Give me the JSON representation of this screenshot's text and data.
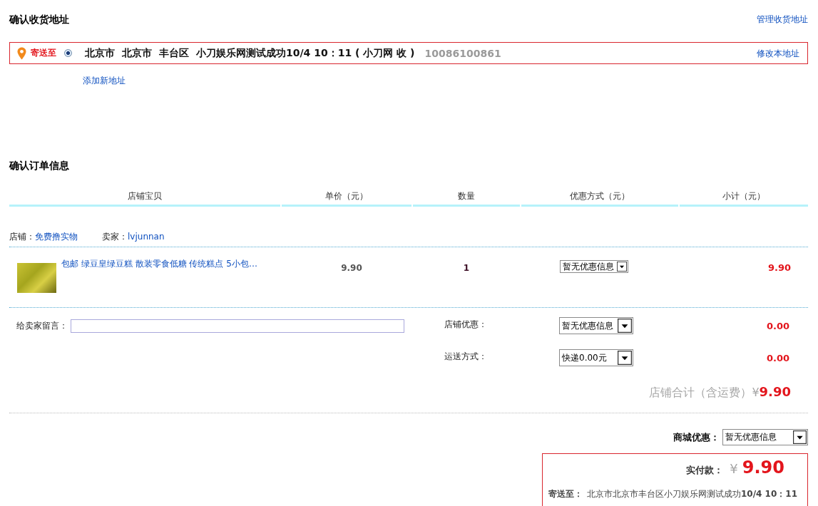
{
  "address_section": {
    "title": "确认收货地址",
    "manage_link": "管理收货地址",
    "addresses": [
      {
        "label": "寄送至",
        "selected": true,
        "parts": [
          "北京市",
          "北京市",
          "丰台区",
          "小刀娱乐网测试成功10/4 10：11 ( 小刀网 收 )"
        ],
        "phone": "10086100861",
        "edit_link": "修改本地址"
      }
    ],
    "add_link": "添加新地址"
  },
  "order_section": {
    "title": "确认订单信息",
    "columns": [
      "店铺宝贝",
      "单价（元）",
      "数量",
      "优惠方式（元）",
      "小计（元）"
    ],
    "shop": {
      "shop_label": "店铺：",
      "shop_name": "免费撸实物",
      "seller_label": "卖家：",
      "seller_name": "lvjunnan"
    },
    "items": [
      {
        "title": "包邮 绿豆皇绿豆糕 散装零食低糖 传统糕点 5小包…",
        "price": "9.90",
        "quantity": "1",
        "discount": "暂无优惠信息",
        "subtotal": "9.90"
      }
    ],
    "message": {
      "label": "给卖家留言："
    },
    "options": [
      {
        "label": "店铺优惠：",
        "value": "暂无优惠信息",
        "amount": "0.00"
      },
      {
        "label": "运送方式：",
        "value": "快递0.00元",
        "amount": "0.00"
      }
    ],
    "shop_total": {
      "label": "店铺合计（含运费）",
      "currency": "¥",
      "amount": "9.90"
    }
  },
  "mall_discount": {
    "label": "商城优惠：",
    "value": "暂无优惠信息"
  },
  "payment": {
    "label": "实付款：",
    "currency": "¥",
    "amount": "9.90",
    "ship_to_label": "寄送至：",
    "ship_to": "北京市北京市丰台区小刀娱乐网测试成功**10/4 10：11**"
  }
}
